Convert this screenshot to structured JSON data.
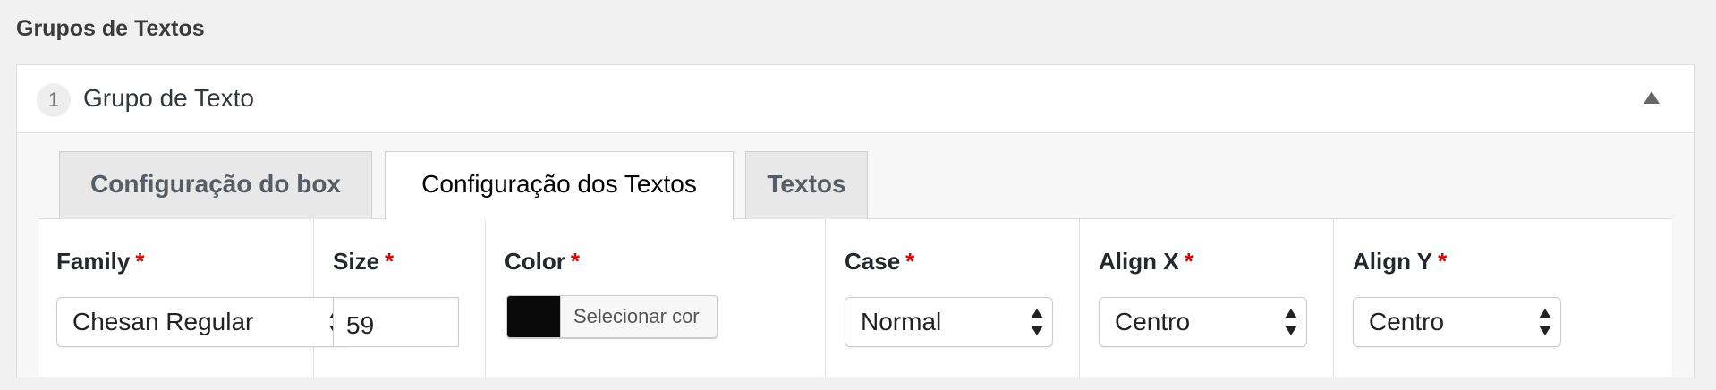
{
  "section": {
    "title": "Grupos de Textos"
  },
  "group": {
    "number": "1",
    "title": "Grupo de Texto",
    "collapse_icon": "triangle-up-icon"
  },
  "tabs": [
    {
      "label": "Configuração do box",
      "active": false
    },
    {
      "label": "Configuração dos Textos",
      "active": true
    },
    {
      "label": "Textos",
      "active": false
    }
  ],
  "fields": {
    "family": {
      "label": "Family",
      "required": "*",
      "value": "Chesan Regular"
    },
    "size": {
      "label": "Size",
      "required": "*",
      "value": "59"
    },
    "color": {
      "label": "Color",
      "required": "*",
      "button_label": "Selecionar cor",
      "value": "#0a0a0a"
    },
    "case": {
      "label": "Case",
      "required": "*",
      "value": "Normal"
    },
    "align_x": {
      "label": "Align X",
      "required": "*",
      "value": "Centro"
    },
    "align_y": {
      "label": "Align Y",
      "required": "*",
      "value": "Centro"
    }
  },
  "colors": {
    "required_star": "#dd0000",
    "active_tab_bg": "#ffffff",
    "inactive_tab_bg": "#e8e8e8"
  }
}
